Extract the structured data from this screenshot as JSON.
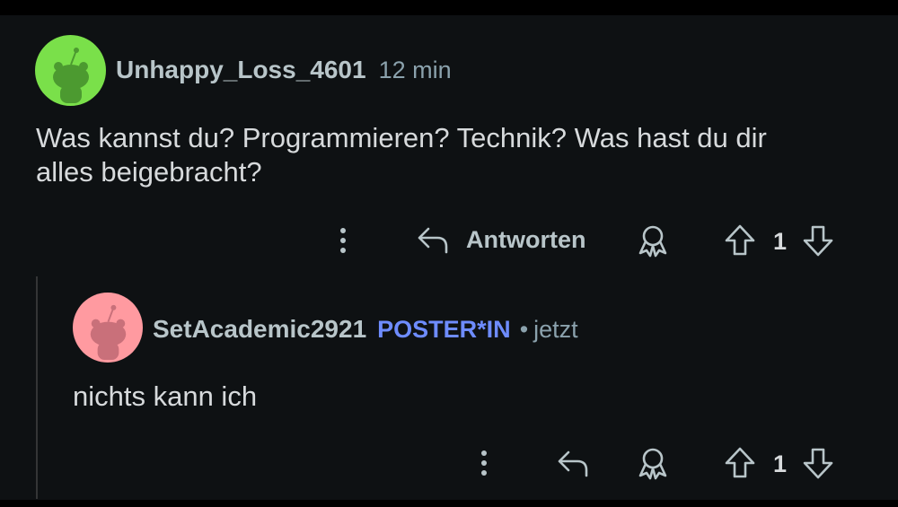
{
  "comment": {
    "username": "Unhappy_Loss_4601",
    "time": "12 min",
    "text": "Was kannst du? Programmieren? Technik? Was hast du dir\nalles beigebracht?",
    "avatar_color": "#7ae04a",
    "actions": {
      "more_icon": "more-vertical-icon",
      "reply_label": "Antworten",
      "award_icon": "award-icon",
      "vote_count": "1"
    }
  },
  "reply": {
    "username": "SetAcademic2921",
    "flair": "POSTER*IN",
    "separator": "•",
    "time": "jetzt",
    "text": "nichts kann ich",
    "avatar_color": "#ff9aa0",
    "actions": {
      "more_icon": "more-vertical-icon",
      "award_icon": "award-icon",
      "vote_count": "1"
    }
  },
  "colors": {
    "flair": "#6e8cff",
    "background": "#0e1113",
    "text": "#d7dadc",
    "muted": "#8ba2ad"
  }
}
